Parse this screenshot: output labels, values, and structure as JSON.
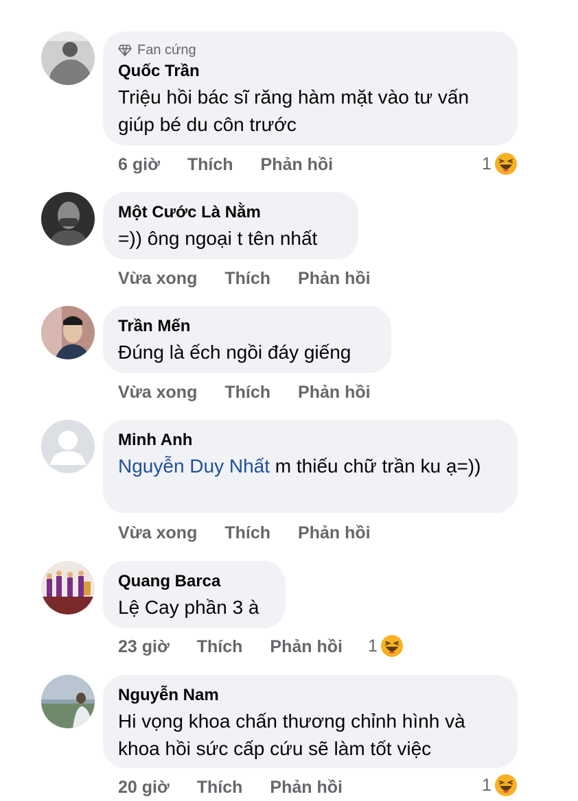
{
  "comments": [
    {
      "badge": "Fan cứng",
      "name": "Quốc Trần",
      "text": "Triệu hồi bác sĩ răng hàm mặt vào tư vấn giúp bé du côn trước",
      "time": "6 giờ",
      "like": "Thích",
      "reply": "Phản hồi",
      "reaction_count": "1",
      "reaction": "haha-emoji"
    },
    {
      "name": "Một Cước Là Nằm",
      "text": "=)) ông ngoại t tên nhất",
      "time": "Vừa xong",
      "like": "Thích",
      "reply": "Phản hồi"
    },
    {
      "name": "Trần Mến",
      "text": "Đúng là ếch ngồi đáy giếng",
      "time": "Vừa xong",
      "like": "Thích",
      "reply": "Phản hồi"
    },
    {
      "name": "Minh Anh",
      "mention": "Nguyễn Duy Nhất",
      "text": " m thiếu chữ trần ku ạ=))",
      "time": "Vừa xong",
      "like": "Thích",
      "reply": "Phản hồi"
    },
    {
      "name": "Quang Barca",
      "text": "Lệ Cay phần 3 à",
      "time": "23 giờ",
      "like": "Thích",
      "reply": "Phản hồi",
      "reaction_count": "1",
      "reaction": "haha-emoji"
    },
    {
      "name": "Nguyễn Nam",
      "text": "Hi vọng khoa chấn thương chỉnh hình và khoa hồi sức cấp cứu sẽ làm tốt việc",
      "time": "20 giờ",
      "like": "Thích",
      "reply": "Phản hồi",
      "reaction_count": "1",
      "reaction": "haha-emoji"
    }
  ],
  "colors": {
    "bubble": "#f0f2f5",
    "meta": "#65676b",
    "mention": "#1f4f9b",
    "haha": "#f7b125"
  }
}
